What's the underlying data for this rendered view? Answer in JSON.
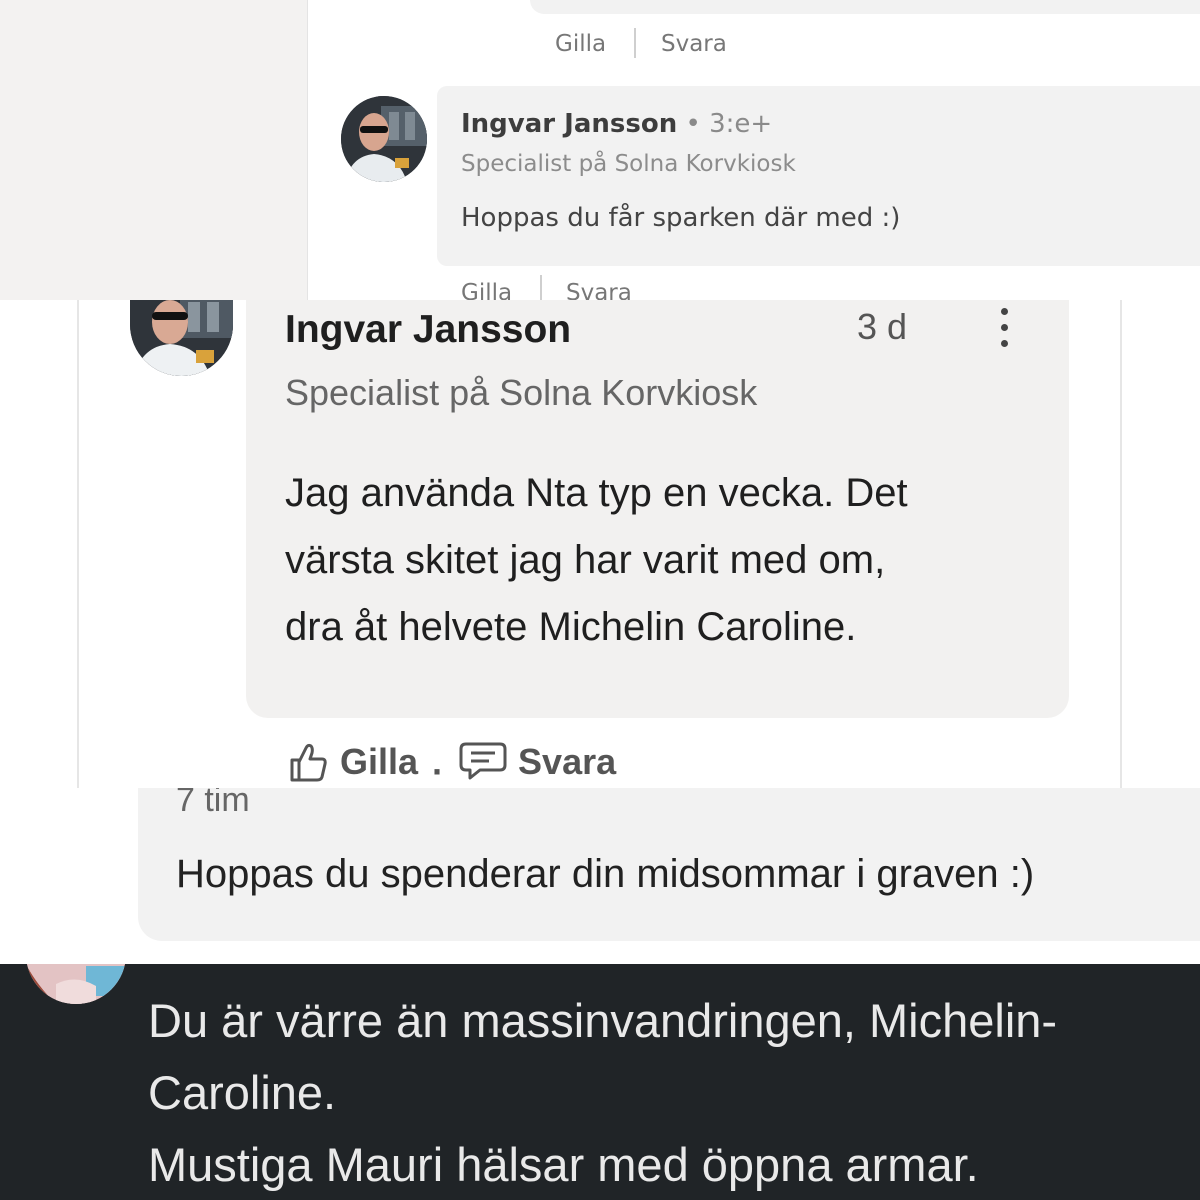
{
  "panel1": {
    "actions_top": {
      "like": "Gilla",
      "reply": "Svara"
    },
    "comment": {
      "author": "Ingvar Jansson",
      "separator": "•",
      "degree": "3:e+",
      "headline": "Specialist på Solna Korvkiosk",
      "text": "Hoppas du får sparken där med :)"
    },
    "actions_bottom": {
      "like": "Gilla",
      "reply": "Svara"
    }
  },
  "panel2": {
    "comment": {
      "author": "Ingvar Jansson",
      "time": "3 d",
      "headline": "Specialist på Solna Korvkiosk",
      "lines": [
        "Jag använda Nta typ en vecka. Det",
        "värsta skitet jag har varit med om,",
        "dra åt helvete Michelin Caroline."
      ]
    },
    "actions": {
      "like": "Gilla",
      "separator": "·",
      "reply": "Svara"
    },
    "icons": {
      "like": "thumbs-up-icon",
      "reply": "speech-bubble-icon",
      "more": "more-vertical-icon"
    }
  },
  "panel3": {
    "time": "7 tim",
    "text": "Hoppas du spenderar din midsommar i graven :)"
  },
  "panel4": {
    "lines": [
      "Du är värre än massinvandringen, Michelin-",
      "Caroline.",
      "Mustiga Mauri hälsar med öppna armar."
    ]
  },
  "colors": {
    "dark_bg": "#202427",
    "bubble": "#f2f2f2"
  }
}
